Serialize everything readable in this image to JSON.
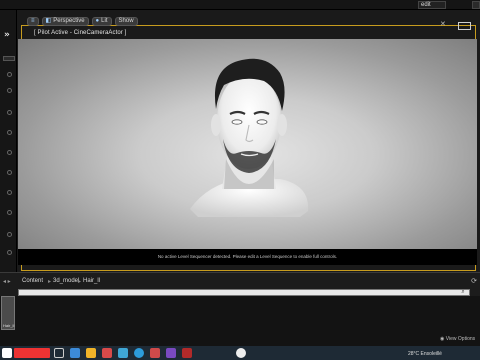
{
  "topbar": {
    "right_label": "edit"
  },
  "viewport": {
    "toolbar": {
      "perspective": "Perspective",
      "lit": "Lit",
      "show": "Show"
    },
    "pilot_label": "[ Pilot Active - CineCameraActor ]",
    "message": "No active Level Sequencer detected. Please edit a Level Sequence to enable full controls.",
    "colors": {
      "outline": "#c79c1e",
      "bg_center": "#e4e4e4",
      "bg_edge": "#7a7a7a"
    }
  },
  "content_browser": {
    "breadcrumbs": [
      "Content",
      "3d_model",
      "Hair_ll"
    ],
    "asset_label": "Hair_ll",
    "view_options": "View Options"
  },
  "taskbar": {
    "weather": "28°C  Ensoleillé",
    "icons": [
      "start-icon",
      "search-icon",
      "task-view-icon",
      "file-explorer-icon",
      "store-icon",
      "mail-icon",
      "browser-icon",
      "edge-icon",
      "chrome-icon",
      "app-icon",
      "app-icon-2",
      "unreal-icon"
    ]
  }
}
